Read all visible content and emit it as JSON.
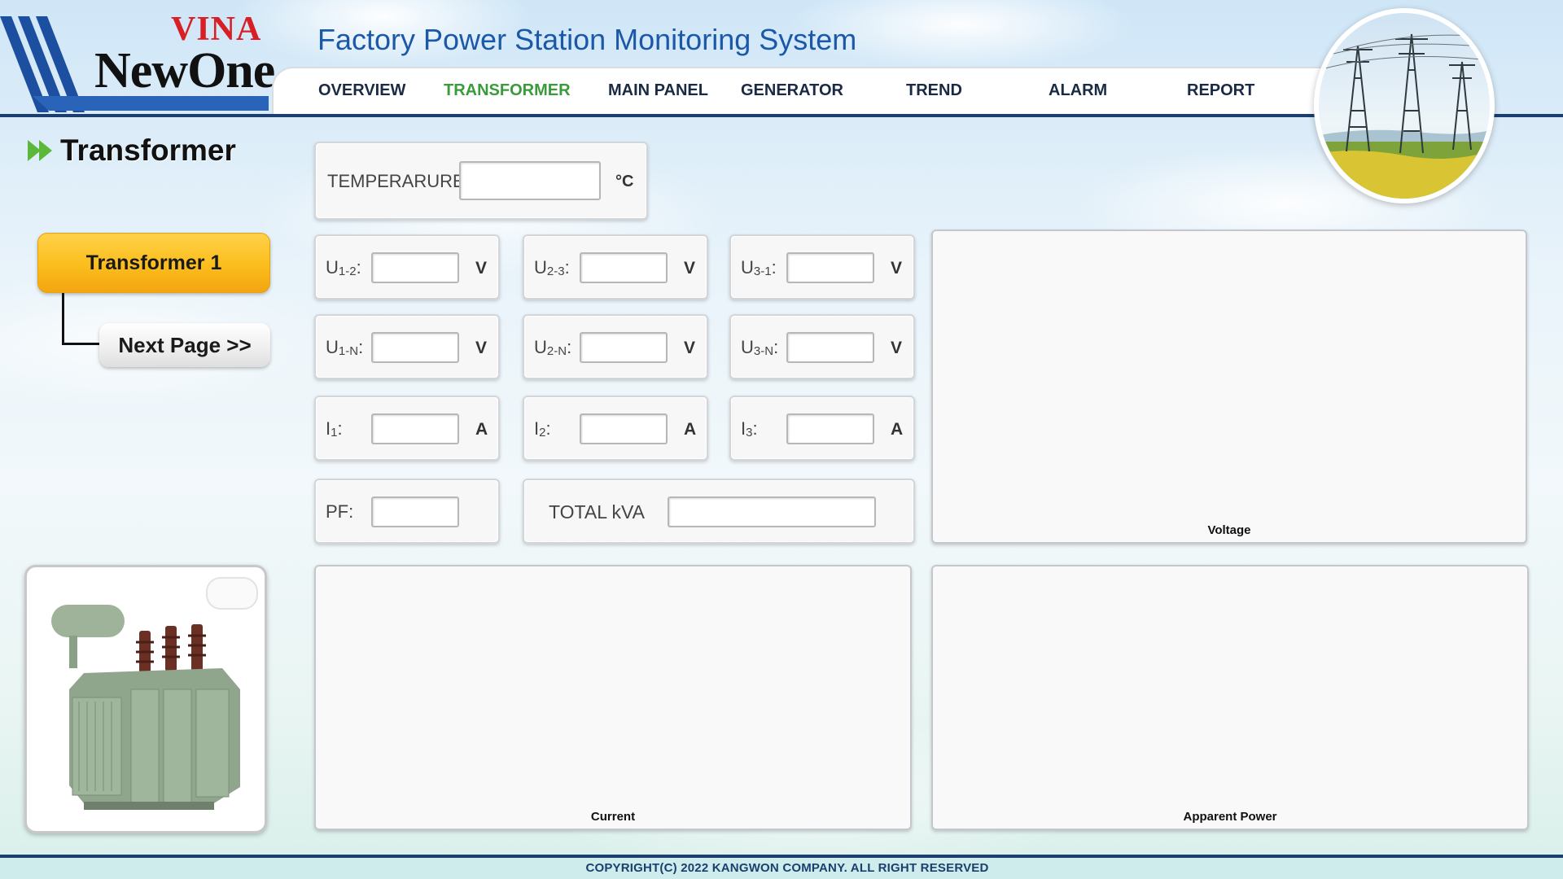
{
  "brand": {
    "top": "VINA",
    "name": "NewOne"
  },
  "app_title": "Factory Power Station Monitoring System",
  "nav": [
    {
      "label": "OVERVIEW",
      "active": false
    },
    {
      "label": "TRANSFORMER",
      "active": true
    },
    {
      "label": "MAIN PANEL",
      "active": false
    },
    {
      "label": "GENERATOR",
      "active": false
    },
    {
      "label": "TREND",
      "active": false
    },
    {
      "label": "ALARM",
      "active": false
    },
    {
      "label": "REPORT",
      "active": false
    }
  ],
  "page_heading": "Transformer",
  "sidebar": {
    "transformer_button": "Transformer 1",
    "next_button": "Next Page >>"
  },
  "temperature": {
    "label": "TEMPERARURE:",
    "value": "",
    "unit": "°C"
  },
  "measurements": {
    "u12": {
      "main": "U",
      "sub": "1-2",
      "suffix": ":",
      "value": "",
      "unit": "V"
    },
    "u23": {
      "main": "U",
      "sub": "2-3",
      "suffix": ":",
      "value": "",
      "unit": "V"
    },
    "u31": {
      "main": "U",
      "sub": "3-1",
      "suffix": ":",
      "value": "",
      "unit": "V"
    },
    "u1n": {
      "main": "U",
      "sub": "1-N",
      "suffix": ":",
      "value": "",
      "unit": "V"
    },
    "u2n": {
      "main": "U",
      "sub": "2-N",
      "suffix": ":",
      "value": "",
      "unit": "V"
    },
    "u3n": {
      "main": "U",
      "sub": "3-N",
      "suffix": ":",
      "value": "",
      "unit": "V"
    },
    "i1": {
      "main": "I",
      "sub": "1",
      "suffix": ":",
      "value": "",
      "unit": "A"
    },
    "i2": {
      "main": "I",
      "sub": "2",
      "suffix": ":",
      "value": "",
      "unit": "A"
    },
    "i3": {
      "main": "I",
      "sub": "3",
      "suffix": ":",
      "value": "",
      "unit": "A"
    },
    "pf": {
      "label": "PF:",
      "value": ""
    },
    "total_kva": {
      "label": "TOTAL kVA",
      "value": ""
    }
  },
  "charts": {
    "voltage": "Voltage",
    "current": "Current",
    "apparent_power": "Apparent Power"
  },
  "footer": "COPYRIGHT(C) 2022 KANGWON COMPANY. ALL RIGHT RESERVED",
  "colors": {
    "nav_active": "#3a9b3a",
    "title_blue": "#1c58a8",
    "navy_line": "#1b3f6e",
    "button_yellow": "#fbbd1c",
    "logo_red": "#d81f26"
  },
  "icons": [
    "logo-stripes-icon",
    "double-chevron-right-icon",
    "power-tower-image",
    "transformer-image"
  ]
}
